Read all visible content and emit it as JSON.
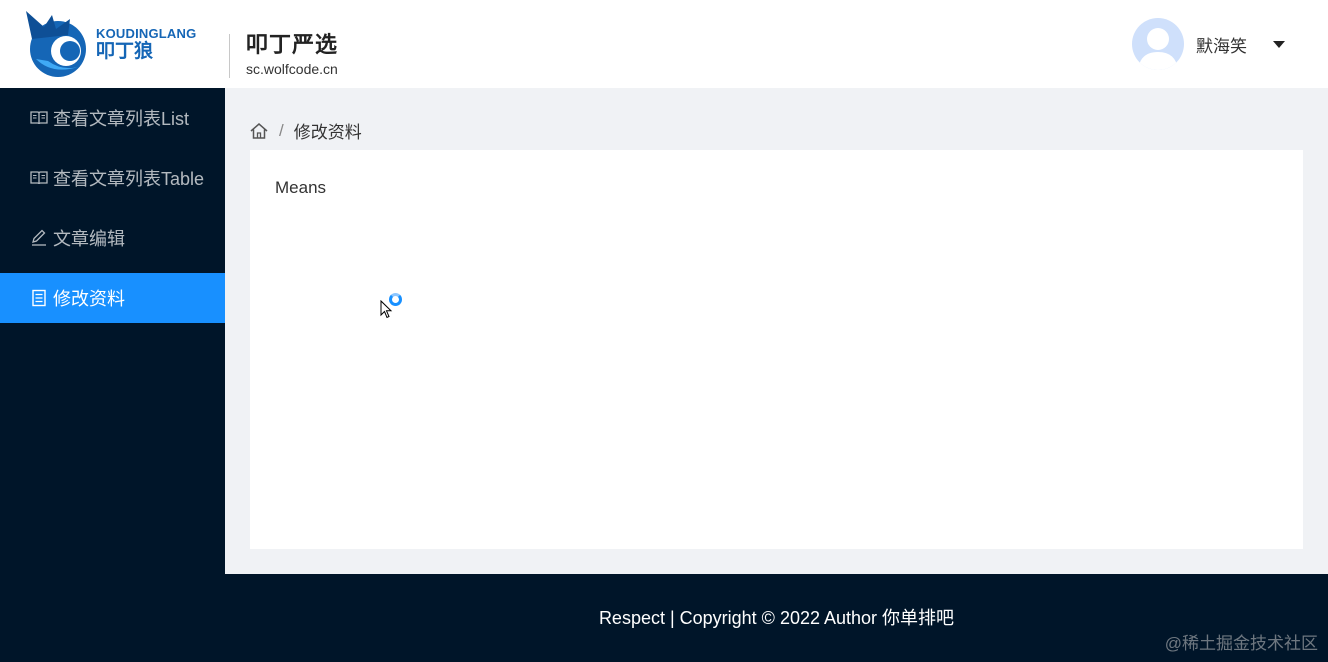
{
  "header": {
    "logo_en": "KOUDINGLANG",
    "logo_cn": "叩丁狼",
    "brand_title": "叩丁严选",
    "brand_subtitle": "sc.wolfcode.cn",
    "user_name": "默海笑"
  },
  "sidebar": {
    "items": [
      {
        "label": "查看文章列表List",
        "icon": "book-icon",
        "active": false
      },
      {
        "label": "查看文章列表Table",
        "icon": "book-icon",
        "active": false
      },
      {
        "label": "文章编辑",
        "icon": "edit-icon",
        "active": false
      },
      {
        "label": "修改资料",
        "icon": "document-icon",
        "active": true
      }
    ]
  },
  "breadcrumb": {
    "home_icon": "home-icon",
    "current": "修改资料"
  },
  "main": {
    "card_text": "Means"
  },
  "footer": {
    "text": "Respect | Copyright © 2022 Author 你单排吧",
    "watermark": "@稀土掘金技术社区"
  },
  "colors": {
    "sidebar_bg": "#001529",
    "active_menu": "#1890ff",
    "content_bg": "#f0f2f5",
    "brand_blue": "#1566b6"
  }
}
